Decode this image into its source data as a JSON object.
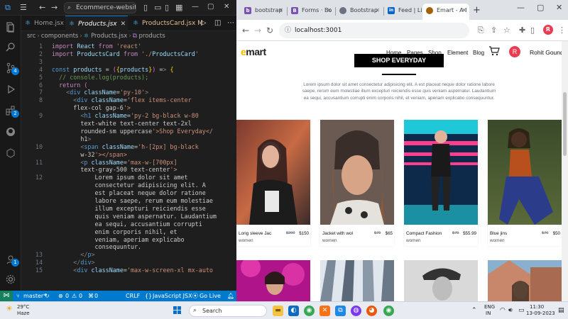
{
  "vscode": {
    "search_text": "Ecommerce-website",
    "tabs": [
      {
        "label": "Home.jsx",
        "state": "normal"
      },
      {
        "label": "Products.jsx",
        "state": "active"
      },
      {
        "label": "ProductsCard.jsx",
        "state": "modified",
        "marker": "M"
      }
    ],
    "breadcrumb": [
      "src",
      "components",
      "Products.jsx",
      "products"
    ],
    "activity_badges": {
      "source_control": "4",
      "extensions": "2",
      "accounts": "1"
    },
    "code_lines": [
      {
        "n": "1",
        "text": "import React from 'react'"
      },
      {
        "n": "2",
        "text": "import ProductsCard from './ProductsCard'"
      },
      {
        "n": "3",
        "text": ""
      },
      {
        "n": "4",
        "text": "const products = ({products}) => {"
      },
      {
        "n": "5",
        "text": "  // console.log(products);"
      },
      {
        "n": "6",
        "text": "  return ("
      },
      {
        "n": "7",
        "text": "    <div className='py-10'>"
      },
      {
        "n": "8",
        "text": "      <div className='flex items-center"
      },
      {
        "n": "",
        "text": "      flex-col gap-6'>"
      },
      {
        "n": "9",
        "text": "        <h1 className='py-2 bg-black w-80"
      },
      {
        "n": "",
        "text": "        text-white text-center text-2xl"
      },
      {
        "n": "",
        "text": "        rounded-sm uppercase'>Shop Everyday</"
      },
      {
        "n": "",
        "text": "        h1>"
      },
      {
        "n": "10",
        "text": "        <span className='h-[2px] bg-black"
      },
      {
        "n": "",
        "text": "        w-32'></span>"
      },
      {
        "n": "11",
        "text": "        <p className='max-w-[700px]"
      },
      {
        "n": "",
        "text": "        text-gray-500 text-center'>"
      },
      {
        "n": "12",
        "text": "            Lorem ipsum dolor sit amet"
      },
      {
        "n": "",
        "text": "            consectetur adipisicing elit. A"
      },
      {
        "n": "",
        "text": "            est placeat neque dolor ratione"
      },
      {
        "n": "",
        "text": "            labore saepe, rerum eum molestiae"
      },
      {
        "n": "",
        "text": "            illum excepturi reiciendis esse"
      },
      {
        "n": "",
        "text": "            quis veniam aspernatur. Laudantium"
      },
      {
        "n": "",
        "text": "            ea sequi, accusantium corrupti"
      },
      {
        "n": "",
        "text": "            enim corporis nihil, et"
      },
      {
        "n": "",
        "text": "            veniam, aperiam explicabo"
      },
      {
        "n": "",
        "text": "            consequuntur."
      },
      {
        "n": "13",
        "text": "        </p>"
      },
      {
        "n": "14",
        "text": "      </div>"
      },
      {
        "n": "15",
        "text": "      <div className='max-w-screen-xl mx-auto"
      }
    ],
    "status": {
      "branch": "master*",
      "sync": "↻",
      "errors": "0",
      "warnings": "0",
      "ports": "0",
      "eol": "CRLF",
      "language": "JavaScript JSX",
      "golive": "Go Live"
    }
  },
  "chrome": {
    "tabs": [
      {
        "label": "bootstrap",
        "fav": "b",
        "fav_color": "#7952b3"
      },
      {
        "label": "Forms · Bo",
        "fav": "B",
        "fav_color": "#7952b3"
      },
      {
        "label": "Bootstrap",
        "fav": "●",
        "fav_color": "#6b7280"
      },
      {
        "label": "Feed | Link",
        "fav": "in",
        "fav_color": "#0a66c2"
      },
      {
        "label": "Emart - A I",
        "fav": "●",
        "fav_color": "#a16207"
      }
    ],
    "new_tab": "+",
    "url": "localhost:3001",
    "profile_initial": "R"
  },
  "site": {
    "logo_accent": "e",
    "logo_rest": "mart",
    "nav": [
      "Home",
      "Pages",
      "Shop",
      "Element",
      "Blog"
    ],
    "user_initial": "R",
    "user_name": "Rohit Gound",
    "banner": "Shop Everyday",
    "lorem": "Lorem ipsum dolor sit amet consectetur adipisicing elit. A est placeat neque dolor ratione labore saepe, rerum eum molestiae illum excepturi reiciendis esse quis veniam aspernatur. Laudantium ea sequi, accusantium corrupti enim corporis nihil, et veniam, aperiam explicabo consequuntur.",
    "products": [
      {
        "name": "Long sleeve Jac",
        "old_price": "$200",
        "price": "$150",
        "category": "women"
      },
      {
        "name": "Jacket with wol",
        "old_price": "$70",
        "price": "$65",
        "category": "women"
      },
      {
        "name": "Compact Fashion",
        "old_price": "$70",
        "price": "$55.99",
        "category": "women"
      },
      {
        "name": "Blue jins",
        "old_price": "$70",
        "price": "$50",
        "category": "women"
      }
    ]
  },
  "taskbar": {
    "temp": "29°C",
    "weather": "Haze",
    "search": "Search",
    "lang": "ENG",
    "region": "IN",
    "time": "11:30",
    "date": "13-09-2023"
  }
}
